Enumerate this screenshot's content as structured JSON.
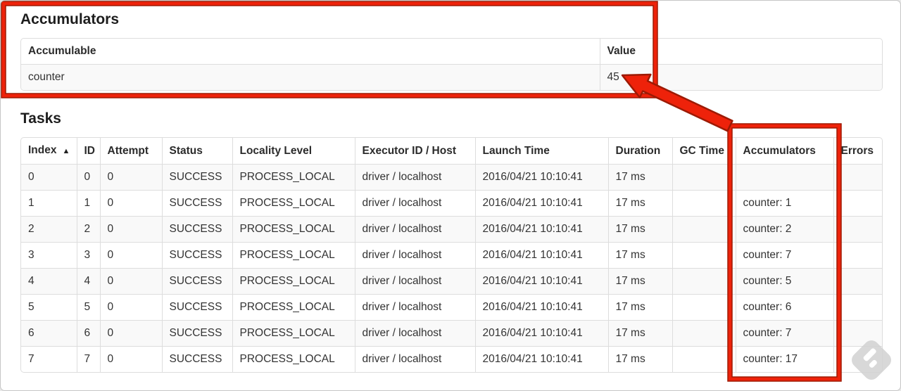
{
  "page": {
    "accumulators_title": "Accumulators",
    "tasks_title": "Tasks"
  },
  "accumulators_table": {
    "headers": {
      "accumulable": "Accumulable",
      "value": "Value"
    },
    "rows": [
      {
        "accumulable": "counter",
        "value": "45"
      }
    ]
  },
  "tasks_table": {
    "headers": {
      "index": "Index",
      "id": "ID",
      "attempt": "Attempt",
      "status": "Status",
      "locality_level": "Locality Level",
      "executor_id_host": "Executor ID / Host",
      "launch_time": "Launch Time",
      "duration": "Duration",
      "gc_time": "GC Time",
      "accumulators": "Accumulators",
      "errors": "Errors"
    },
    "sort_indicator": "▲",
    "rows": [
      {
        "index": "0",
        "id": "0",
        "attempt": "0",
        "status": "SUCCESS",
        "locality_level": "PROCESS_LOCAL",
        "executor_id_host": "driver / localhost",
        "launch_time": "2016/04/21 10:10:41",
        "duration": "17 ms",
        "gc_time": "",
        "accumulators": "",
        "errors": ""
      },
      {
        "index": "1",
        "id": "1",
        "attempt": "0",
        "status": "SUCCESS",
        "locality_level": "PROCESS_LOCAL",
        "executor_id_host": "driver / localhost",
        "launch_time": "2016/04/21 10:10:41",
        "duration": "17 ms",
        "gc_time": "",
        "accumulators": "counter: 1",
        "errors": ""
      },
      {
        "index": "2",
        "id": "2",
        "attempt": "0",
        "status": "SUCCESS",
        "locality_level": "PROCESS_LOCAL",
        "executor_id_host": "driver / localhost",
        "launch_time": "2016/04/21 10:10:41",
        "duration": "17 ms",
        "gc_time": "",
        "accumulators": "counter: 2",
        "errors": ""
      },
      {
        "index": "3",
        "id": "3",
        "attempt": "0",
        "status": "SUCCESS",
        "locality_level": "PROCESS_LOCAL",
        "executor_id_host": "driver / localhost",
        "launch_time": "2016/04/21 10:10:41",
        "duration": "17 ms",
        "gc_time": "",
        "accumulators": "counter: 7",
        "errors": ""
      },
      {
        "index": "4",
        "id": "4",
        "attempt": "0",
        "status": "SUCCESS",
        "locality_level": "PROCESS_LOCAL",
        "executor_id_host": "driver / localhost",
        "launch_time": "2016/04/21 10:10:41",
        "duration": "17 ms",
        "gc_time": "",
        "accumulators": "counter: 5",
        "errors": ""
      },
      {
        "index": "5",
        "id": "5",
        "attempt": "0",
        "status": "SUCCESS",
        "locality_level": "PROCESS_LOCAL",
        "executor_id_host": "driver / localhost",
        "launch_time": "2016/04/21 10:10:41",
        "duration": "17 ms",
        "gc_time": "",
        "accumulators": "counter: 6",
        "errors": ""
      },
      {
        "index": "6",
        "id": "6",
        "attempt": "0",
        "status": "SUCCESS",
        "locality_level": "PROCESS_LOCAL",
        "executor_id_host": "driver / localhost",
        "launch_time": "2016/04/21 10:10:41",
        "duration": "17 ms",
        "gc_time": "",
        "accumulators": "counter: 7",
        "errors": ""
      },
      {
        "index": "7",
        "id": "7",
        "attempt": "0",
        "status": "SUCCESS",
        "locality_level": "PROCESS_LOCAL",
        "executor_id_host": "driver / localhost",
        "launch_time": "2016/04/21 10:10:41",
        "duration": "17 ms",
        "gc_time": "",
        "accumulators": "counter: 17",
        "errors": ""
      }
    ]
  },
  "annotations": {
    "red_fill": "#ee220a",
    "red_dark_edge": "#9d1a04",
    "highlight_targets": [
      "accumulators-summary",
      "accumulators-column"
    ]
  },
  "colors": {
    "table_border": "#dddddd",
    "row_stripe": "#f9f9f9",
    "text": "#333333"
  }
}
